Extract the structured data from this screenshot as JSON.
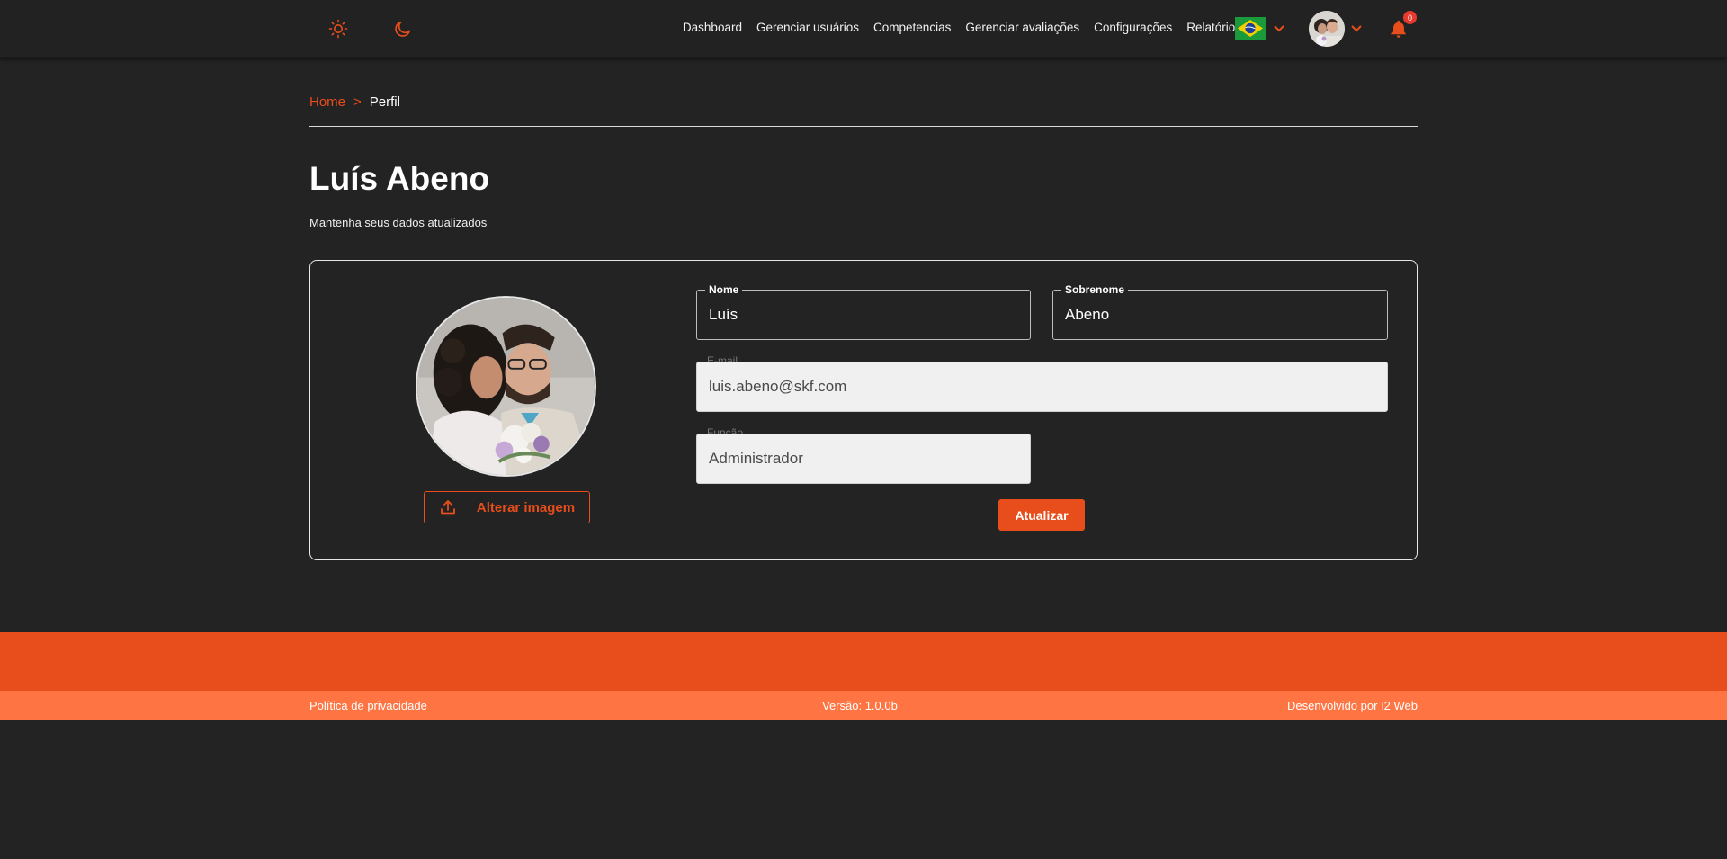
{
  "colors": {
    "accent": "#e84e1b",
    "footer_band": "#e84e1b",
    "footer_bar": "#ff7443",
    "background": "#232323",
    "input_filled_bg": "#f0f0f0"
  },
  "header": {
    "theme_toggle": {
      "light_icon": "sun-icon",
      "dark_icon": "moon-icon"
    },
    "nav_items": [
      "Dashboard",
      "Gerenciar usuários",
      "Competencias",
      "Gerenciar avaliações",
      "Configurações",
      "Relatórios"
    ],
    "language_icon": "brazil-flag-icon",
    "notifications": {
      "icon": "bell-icon",
      "count": "0"
    }
  },
  "breadcrumb": {
    "home": "Home",
    "separator": ">",
    "current": "Perfil"
  },
  "page": {
    "title": "Luís Abeno",
    "subtitle": "Mantenha seus dados atualizados"
  },
  "profile": {
    "change_image_label": "Alterar imagem",
    "change_image_icon": "upload-icon",
    "fields": {
      "first_name": {
        "label": "Nome",
        "value": "Luís"
      },
      "last_name": {
        "label": "Sobrenome",
        "value": "Abeno"
      },
      "email": {
        "label": "E-mail",
        "value": "luis.abeno@skf.com"
      },
      "role": {
        "label": "Função",
        "value": "Administrador"
      }
    },
    "submit_label": "Atualizar"
  },
  "footer": {
    "privacy": "Política de privacidade",
    "version": "Versão: 1.0.0b",
    "credits": "Desenvolvido por I2 Web"
  }
}
